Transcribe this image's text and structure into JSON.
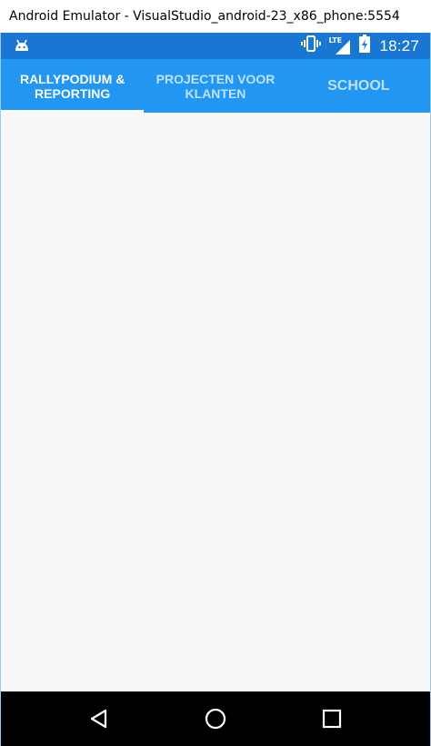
{
  "window": {
    "title": "Android Emulator - VisualStudio_android-23_x86_phone:5554"
  },
  "status_bar": {
    "time": "18:27",
    "network_label": "LTE",
    "left_icon": "android-icon",
    "icons": [
      "vibrate-icon",
      "lte-signal-icon",
      "battery-charging-icon"
    ],
    "color": "#1976d2"
  },
  "tabs": [
    {
      "label": "RALLYPODIUM & REPORTING",
      "active": true
    },
    {
      "label": "PROJECTEN VOOR KLANTEN",
      "active": false
    },
    {
      "label": "SCHOOL",
      "active": false
    }
  ],
  "colors": {
    "tab_bar": "#2196f3",
    "content_background": "#f8f8f8",
    "nav_bar": "#000000"
  },
  "nav_bar": {
    "buttons": [
      "back-icon",
      "home-icon",
      "recents-icon"
    ]
  }
}
